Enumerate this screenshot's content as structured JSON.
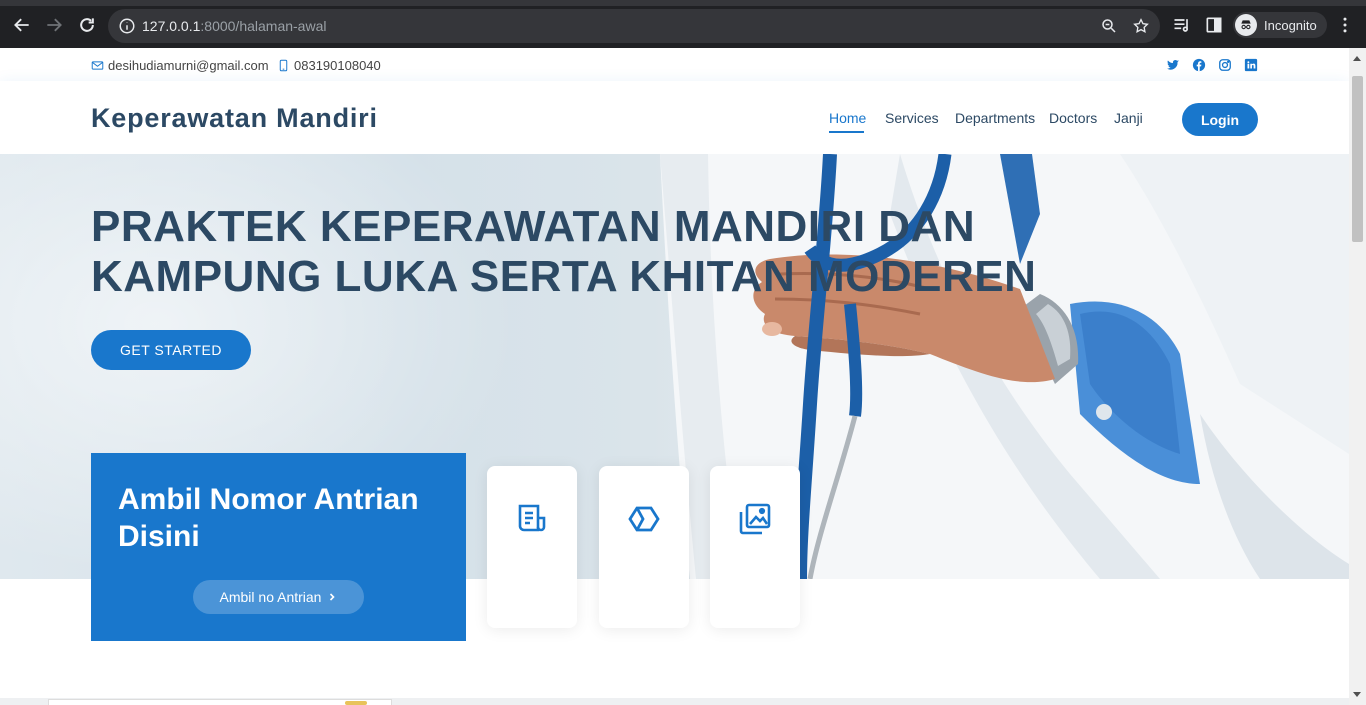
{
  "browser": {
    "url_host": "127.0.0.1",
    "url_path": ":8000/halaman-awal",
    "profile_label": "Incognito"
  },
  "topbar": {
    "email": "desihudiamurni@gmail.com",
    "phone": "083190108040",
    "socials": [
      "twitter-icon",
      "facebook-icon",
      "instagram-icon",
      "linkedin-icon"
    ]
  },
  "header": {
    "logo": "Keperawatan Mandiri",
    "nav": [
      {
        "label": "Home",
        "active": true
      },
      {
        "label": "Services"
      },
      {
        "label": "Departments"
      },
      {
        "label": "Doctors"
      },
      {
        "label": "Janji"
      }
    ],
    "login_label": "Login"
  },
  "hero": {
    "title": "PRAKTEK KEPERAWATAN MANDIRI DAN KAMPUNG LUKA SERTA KHITAN MODEREN",
    "cta_label": "GET STARTED"
  },
  "queue": {
    "title": "Ambil Nomor Antrian Disini",
    "button_label": "Ambil no Antrian",
    "button_icon": "chevron-right-icon"
  },
  "cards": [
    {
      "icon": "receipt-icon"
    },
    {
      "icon": "cube-icon"
    },
    {
      "icon": "images-icon"
    }
  ],
  "colors": {
    "primary": "#1977cc",
    "heading": "#2c4964",
    "chrome_bg": "#202124"
  }
}
